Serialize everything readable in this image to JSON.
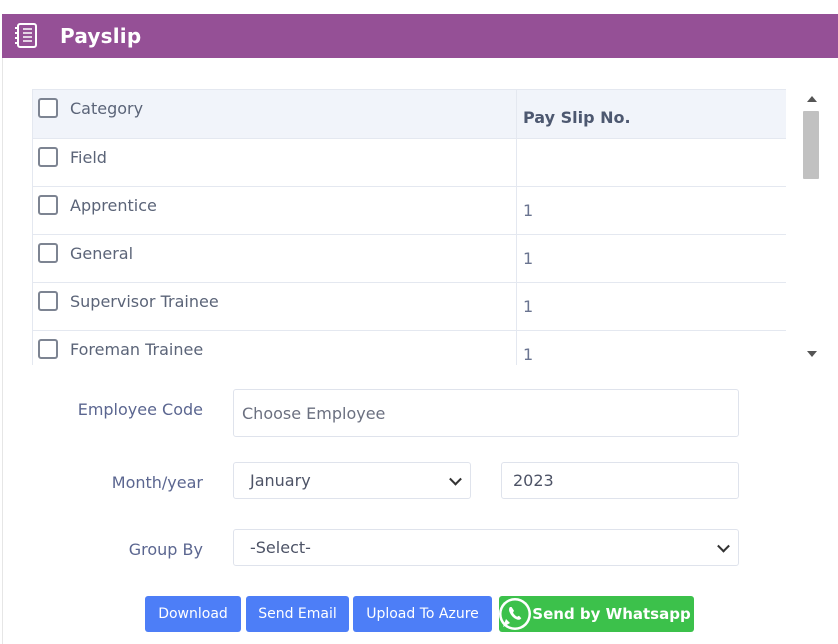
{
  "header": {
    "title": "Payslip",
    "icon": "document-list-icon"
  },
  "table": {
    "columns": [
      "Category",
      "Pay Slip No."
    ],
    "rows": [
      {
        "category": "Field",
        "payslip_no": ""
      },
      {
        "category": "Apprentice",
        "payslip_no": "1"
      },
      {
        "category": "General",
        "payslip_no": "1"
      },
      {
        "category": "Supervisor Trainee",
        "payslip_no": "1"
      },
      {
        "category": "Foreman Trainee",
        "payslip_no": "1"
      }
    ]
  },
  "form": {
    "employee_code_label": "Employee Code",
    "employee_placeholder": "Choose Employee",
    "month_year_label": "Month/year",
    "month_value": "January",
    "year_value": "2023",
    "group_by_label": "Group By",
    "group_by_value": "-Select-"
  },
  "buttons": {
    "download": "Download",
    "send_email": "Send Email",
    "upload_azure": "Upload To Azure",
    "whatsapp": "Send by Whatsapp"
  },
  "colors": {
    "header": "#955096",
    "button_blue": "#4d7ef7",
    "button_green": "#3cc14b"
  }
}
